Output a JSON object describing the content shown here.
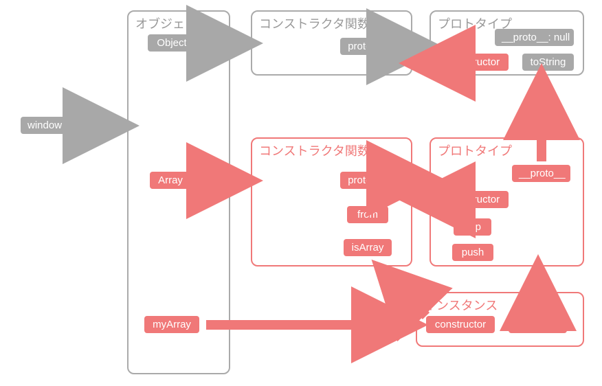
{
  "nodes": {
    "window": "window",
    "object_box_title": "オブジェクト",
    "object_pill": "Object",
    "array_pill": "Array",
    "myarray_pill": "myArray",
    "obj_ctor_title": "コンストラクタ関数",
    "obj_ctor_prototype": "prototype",
    "obj_proto_title": "プロトタイプ",
    "obj_proto_proto": "__proto__: null",
    "obj_proto_constructor": "constructor",
    "obj_proto_tostring": "toString",
    "arr_ctor_title": "コンストラクタ関数",
    "arr_ctor_prototype": "prototype",
    "arr_ctor_from": "from",
    "arr_ctor_isarray": "isArray",
    "arr_proto_title": "プロトタイプ",
    "arr_proto_constructor": "constructor",
    "arr_proto_pop": "pop",
    "arr_proto_push": "push",
    "arr_proto_proto": "__proto__",
    "inst_title": "インスタンス",
    "inst_constructor": "constructor",
    "inst_proto": "__proto__"
  },
  "colors": {
    "gray": "#a8a8a8",
    "red": "#f07878"
  },
  "relationships": [
    {
      "from": "window",
      "to": "object_box",
      "color": "gray"
    },
    {
      "from": "object_pill",
      "to": "obj_ctor_box",
      "color": "gray"
    },
    {
      "from": "obj_ctor_prototype",
      "to": "obj_proto_box",
      "color": "gray"
    },
    {
      "from": "obj_proto_constructor",
      "to": "obj_ctor_box",
      "color": "red"
    },
    {
      "from": "array_pill",
      "to": "arr_ctor_box",
      "color": "red"
    },
    {
      "from": "arr_ctor_prototype",
      "to": "arr_proto_box",
      "color": "red"
    },
    {
      "from": "arr_proto_constructor",
      "to": "arr_ctor_box",
      "color": "red"
    },
    {
      "from": "arr_proto_proto",
      "to": "obj_proto_box",
      "color": "red"
    },
    {
      "from": "myarray_pill",
      "to": "inst_box",
      "color": "red"
    },
    {
      "from": "inst_constructor",
      "to": "arr_ctor_box",
      "color": "red"
    },
    {
      "from": "inst_proto",
      "to": "arr_proto_box",
      "color": "red"
    }
  ]
}
